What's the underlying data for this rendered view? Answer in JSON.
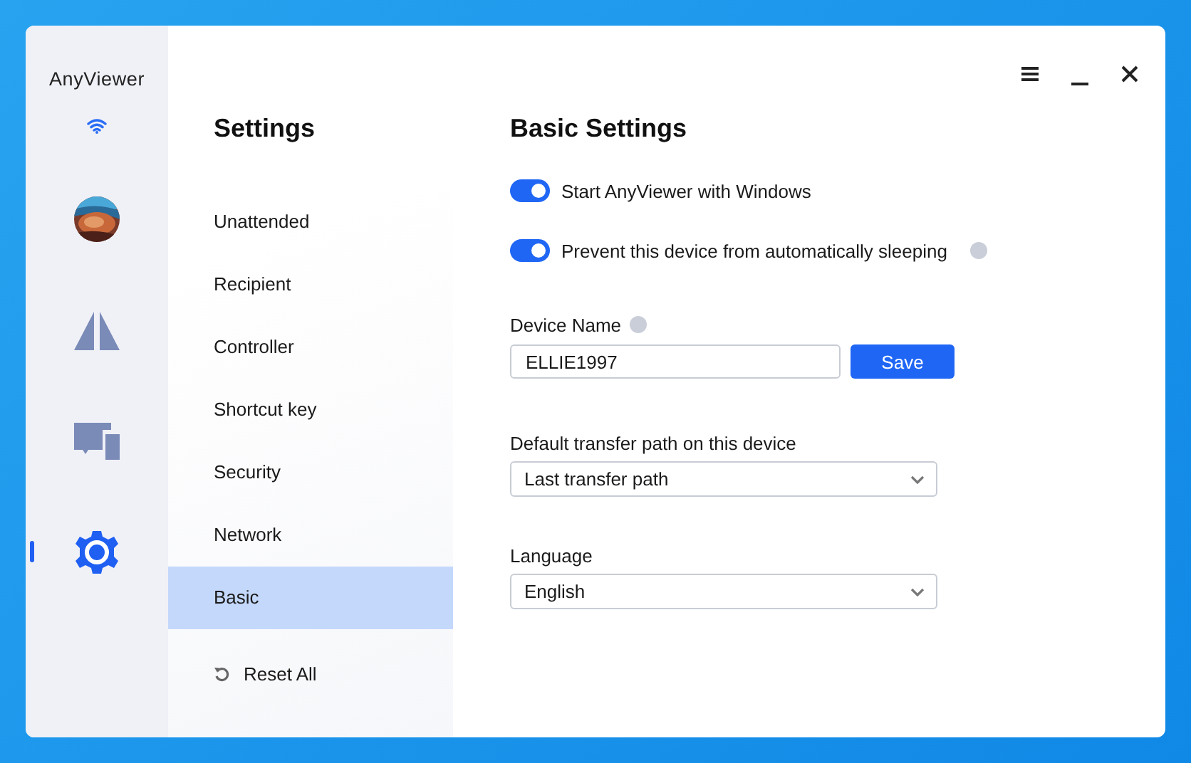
{
  "app_name": "AnyViewer",
  "rail": [
    {
      "kind": "wifi"
    },
    {
      "kind": "avatar"
    },
    {
      "kind": "connect",
      "selected": false
    },
    {
      "kind": "devices",
      "selected": false
    },
    {
      "kind": "settings",
      "selected": true
    }
  ],
  "menu": {
    "title": "Settings",
    "items": [
      {
        "label": "Unattended",
        "selected": false
      },
      {
        "label": "Recipient",
        "selected": false
      },
      {
        "label": "Controller",
        "selected": false
      },
      {
        "label": "Shortcut key",
        "selected": false
      },
      {
        "label": "Security",
        "selected": false
      },
      {
        "label": "Network",
        "selected": false
      },
      {
        "label": "Basic",
        "selected": true
      }
    ],
    "reset": "Reset All"
  },
  "content": {
    "title": "Basic Settings",
    "toggles": [
      {
        "label": "Start AnyViewer with Windows",
        "on": true,
        "help": false
      },
      {
        "label": "Prevent this device from automatically sleeping",
        "on": true,
        "help": true
      }
    ],
    "device_name": {
      "label": "Device Name",
      "help": true,
      "value": "ELLIE1997",
      "button": "Save"
    },
    "selects": [
      {
        "label": "Default transfer path on this device",
        "value": "Last transfer path"
      },
      {
        "label": "Language",
        "value": "English"
      }
    ]
  }
}
